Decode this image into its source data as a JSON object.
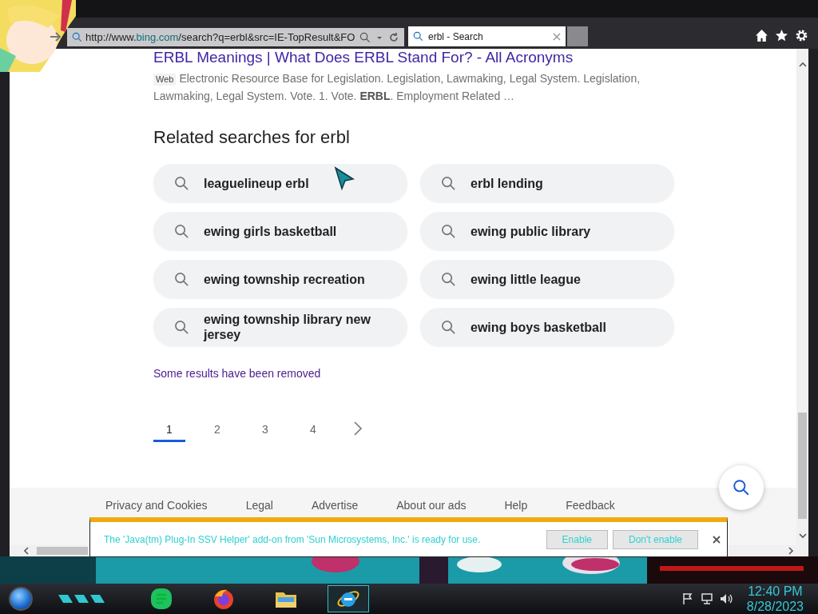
{
  "browser": {
    "address": {
      "prefix": "http://www.",
      "domain": "bing.com",
      "rest": "/search?q=erbl&src=IE-TopResult&FO"
    },
    "tabs": [
      {
        "label": "erbl - Search",
        "selected": true
      }
    ]
  },
  "result": {
    "title": "ERBL Meanings | What Does ERBL Stand For? - All Acronyms",
    "badge": "Web",
    "snippet": "Electronic Resource Base for Legislation. Legislation, Lawmaking, Legal System. Legislation, Lawmaking, Legal System. Vote. 1. Vote. **ERBL**. Employment Related …"
  },
  "related": {
    "heading": "Related searches for erbl",
    "items": [
      {
        "label": "leaguelineup erbl"
      },
      {
        "label": "erbl lending"
      },
      {
        "label": "ewing girls basketball"
      },
      {
        "label": "ewing public library"
      },
      {
        "label": "ewing township recreation"
      },
      {
        "label": "ewing little league"
      },
      {
        "label": "ewing township library new jersey"
      },
      {
        "label": "ewing boys basketball"
      }
    ]
  },
  "removed_note": "Some results have been removed",
  "pagination": [
    {
      "label": "1",
      "selected": true
    },
    {
      "label": "2",
      "selected": false
    },
    {
      "label": "3",
      "selected": false
    },
    {
      "label": "4",
      "selected": false
    }
  ],
  "footer_links": [
    "Privacy and Cookies",
    "Legal",
    "Advertise",
    "About our ads",
    "Help",
    "Feedback"
  ],
  "notification": {
    "message": "The 'Java(tm) Plug-In SSV Helper' add-on from 'Sun Microsystems, Inc.' is ready for use.",
    "buttons": [
      "Enable",
      "Don't enable"
    ]
  },
  "taskbar": {
    "apps": [
      {
        "kind": "chat",
        "selected": false
      },
      {
        "kind": "firefox",
        "selected": false
      },
      {
        "kind": "folder",
        "selected": false
      },
      {
        "kind": "ie",
        "selected": true
      }
    ],
    "time": "12:40 PM",
    "date": "8/28/2023"
  }
}
